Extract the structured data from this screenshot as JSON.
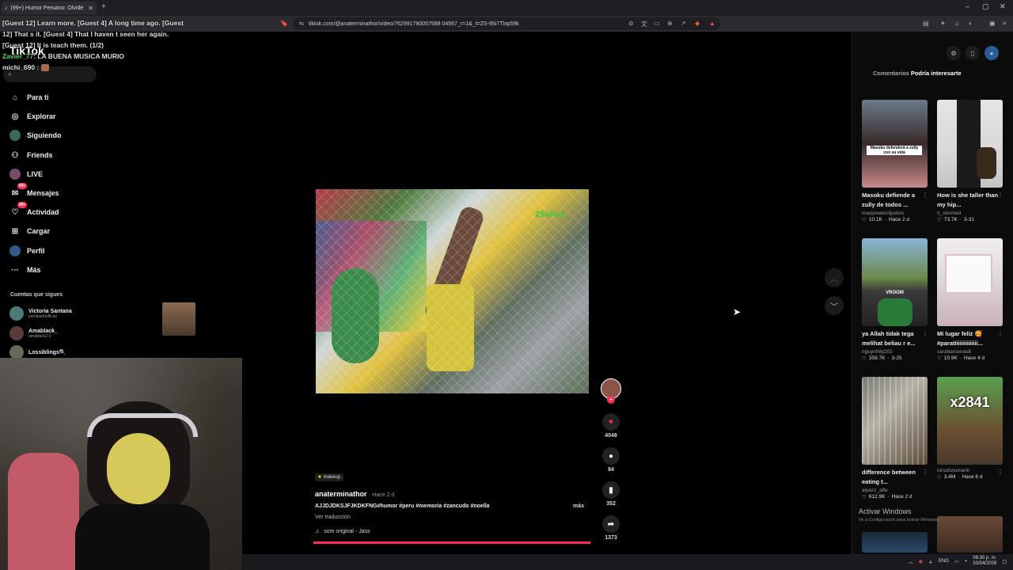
{
  "browser": {
    "tab_title": "(99+) Humor Peruano: Olvidé",
    "new_tab": "+",
    "url": "tiktok.com/@anaterminathor/video/762991780057588 04567_r=1&_t=ZS-95i7Tlxp59k",
    "win_min": "–",
    "win_max": "▢",
    "win_close": "✕"
  },
  "chat": {
    "line1": "[Guest 12] Learn more. [Guest 4] A long time ago. [Guest 12] That s it. [Guest 4] That I haven t seen her again. [Guest 12] It is teach them. (1/2)",
    "user1": "Zavier_77",
    "msg1": ": LA BUENA MUSICA MURIO",
    "user2": "michi_690",
    "msg2": ":"
  },
  "logo": "TikTok",
  "nav": [
    {
      "label": "Para ti",
      "icon": "⌂"
    },
    {
      "label": "Explorar",
      "icon": "◎"
    },
    {
      "label": "Siguiendo",
      "icon": "◉"
    },
    {
      "label": "Friends",
      "icon": "👥"
    },
    {
      "label": "LIVE",
      "icon": "●"
    },
    {
      "label": "Mensajes",
      "icon": "✉",
      "badge": "99+"
    },
    {
      "label": "Actividad",
      "icon": "♥",
      "badge": "99+"
    },
    {
      "label": "Cargar",
      "icon": "⊞"
    },
    {
      "label": "Perfil",
      "icon": "●"
    },
    {
      "label": "Más",
      "icon": "···"
    }
  ],
  "following_header": "Cuentas que sigues",
  "following": [
    {
      "name": "Victoria Santana",
      "user": "panfipanfiofficial"
    },
    {
      "name": "Amablack_",
      "user": "amablack2.0"
    },
    {
      "name": "Lossiblings🔍",
      "user": ""
    }
  ],
  "video": {
    "watermark": "25años",
    "tag": "makeup",
    "author": "anaterminathor",
    "time": "· Hace 2 d",
    "caption": "AJJDJDKSJFJKDKFNG#humor #peru #memoria #zancudo #noella",
    "more": "más",
    "translate": "Ver traducción",
    "sound": "som original - Jass",
    "likes": "4048",
    "comments": "84",
    "saves": "352",
    "shares": "1373",
    "progress": 1.0
  },
  "right_panel": {
    "tab_comments": "Comentarios",
    "tab_interest": "Podría interesarte",
    "cards": [
      {
        "title": "Masoku defiende a zully de todos ...",
        "user": "maxpowerclipsitos",
        "views": "10.1K",
        "time": "Hace 2 d",
        "thumb_text": "Masoku defenderá a zully con su vida"
      },
      {
        "title": "How is she taller than my hip...",
        "user": "it_stormed",
        "views": "73.7K",
        "time": "3-31",
        "thumb_text": ""
      },
      {
        "title": "ya Allah tidak tega melihat beliau r e...",
        "user": "nguynthly202",
        "views": "359.7K",
        "time": "3-25",
        "thumb_text": "VROOM"
      },
      {
        "title": "Mi lugar feliz 🥰 #paratiiiiiiiiiiiiii...",
        "user": "sarabarcenas8",
        "views": "10.9K",
        "time": "Hace 4 d",
        "thumb_text": ""
      },
      {
        "title": "difference between eating t...",
        "user": "aiyazz_alfe",
        "views": "612.9K",
        "time": "Hace 2 d",
        "thumb_text": ""
      },
      {
        "title": "",
        "user": "ionutliviumarin",
        "views": "3.4M",
        "time": "Hace 6 d",
        "thumb_text": "x2841"
      }
    ],
    "activate_windows": "Activar Windows",
    "activate_windows_sub": "Ve a Configuración para activar Windows."
  },
  "taskbar": {
    "lang": "ENG",
    "time": "08:30 p. m.",
    "date": "20/04/2026"
  }
}
